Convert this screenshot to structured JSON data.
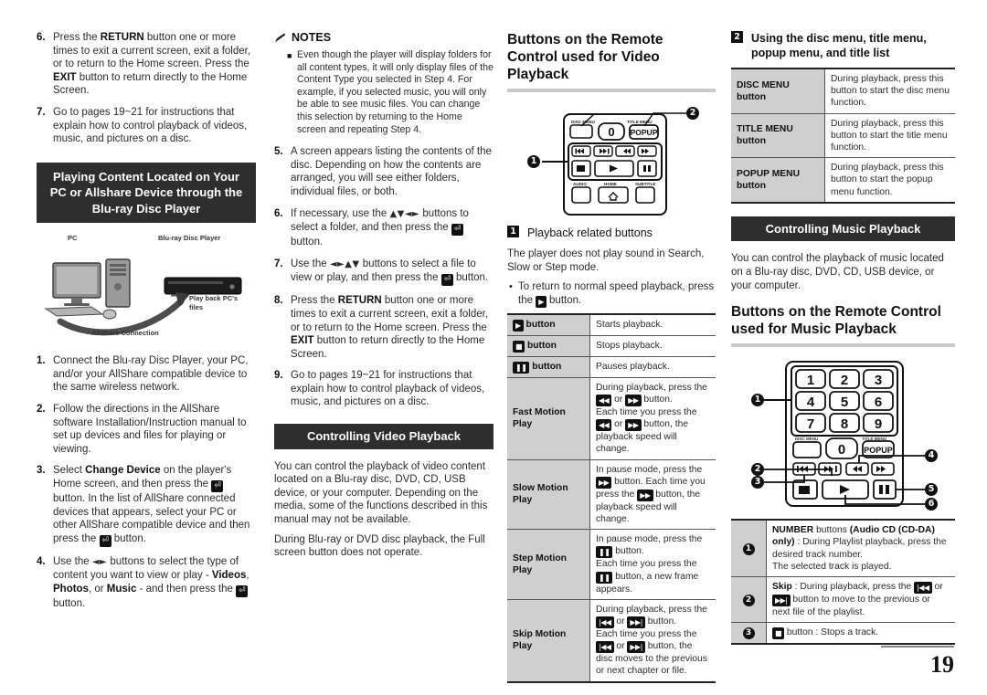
{
  "page_number": "19",
  "col1": {
    "steps_top": [
      {
        "num": "6.",
        "text": "Press the RETURN button one or more times to exit a current screen, exit a folder, or to return to the Home screen. Press the EXIT button to return directly to the Home Screen.",
        "bold_words": [
          "RETURN",
          "EXIT"
        ]
      },
      {
        "num": "7.",
        "text": "Go to pages 19~21 for instructions that explain how to control playback of videos, music, and pictures on a disc.",
        "bold_words": []
      }
    ],
    "section_title": "Playing Content Located on Your PC or Allshare Device through the Blu-ray Disc Player",
    "figure": {
      "name": "allshare-connection-diagram",
      "label_pc": "PC",
      "label_player": "Blu-ray Disc Player",
      "label_playback": "Play back PC's files",
      "label_connection": "AllShare Connection"
    },
    "steps_bottom": [
      {
        "num": "1.",
        "text": "Connect the Blu-ray Disc Player, your PC, and/or your AllShare compatible device to the same wireless network."
      },
      {
        "num": "2.",
        "text": "Follow the directions in the AllShare software Installation/Instruction manual to set up devices and files for playing or viewing."
      },
      {
        "num": "3.",
        "text": "Select Change Device on the player's Home screen, and then press the [E] button. In the list of AllShare connected devices that appears, select your PC or other AllShare compatible device and then press the [E] button."
      },
      {
        "num": "4.",
        "text": "Use the ◄► buttons to select the type of content you want to view or play - Videos, Photos, or Music - and then press the [E] button."
      }
    ]
  },
  "col2": {
    "notes_title": "NOTES",
    "notes_icon": "pencil-icon",
    "note_items": [
      "Even though the player will display folders for all content types, it will only display files of the Content Type you selected in Step 4. For example, if you selected music, you will only be able to see music files. You can change this selection by returning to the Home screen and repeating Step 4."
    ],
    "steps": [
      {
        "num": "5.",
        "text": "A screen appears listing the contents of the disc. Depending on how the contents are arranged, you will see either folders, individual files, or both."
      },
      {
        "num": "6.",
        "text": "If necessary, use the ▲▼◄► buttons to select a folder, and then press the [E] button."
      },
      {
        "num": "7.",
        "text": "Use the ◄►▲▼ buttons to select a file to view or play, and then press the [E] button."
      },
      {
        "num": "8.",
        "text": "Press the RETURN button one or more times to exit a current screen, exit a folder, or to return to the Home screen. Press the EXIT button to return directly to the Home Screen."
      },
      {
        "num": "9.",
        "text": "Go to pages 19~21 for instructions that explain how to control playback of videos, music, and pictures on a disc."
      }
    ],
    "section_title": "Controlling Video Playback",
    "paragraphs": [
      "You can control the playback of video content located on a Blu-ray disc, DVD, CD, USB device, or your computer. Depending on the media, some of the functions described in this manual may not be available.",
      "During Blu-ray or DVD disc playback, the Full screen button does not operate."
    ]
  },
  "col3": {
    "heading": "Buttons on the Remote Control used for Video Playback",
    "remote_figure": {
      "name": "video-remote-diagram",
      "label_disc_menu": "DISC MENU",
      "label_title_menu": "TITLE MENU",
      "label_popup": "POPUP",
      "label_zero": "0",
      "label_audio": "AUDIO",
      "label_home": "HOME",
      "label_subtitle": "SUBTITLE",
      "callout_1": "1",
      "callout_2": "2"
    },
    "callout_label": "Playback related buttons",
    "callout_number": "1",
    "intro": "The player does not play sound in Search, Slow or Step mode.",
    "bullet": "To return to normal speed playback, press the [play] button.",
    "table": [
      {
        "label_icon": "play-icon",
        "label": "button",
        "desc": "Starts playback."
      },
      {
        "label_icon": "stop-icon",
        "label": "button",
        "desc": "Stops playback."
      },
      {
        "label_icon": "pause-icon",
        "label": "button",
        "desc": "Pauses playback."
      },
      {
        "label_icon": "",
        "label": "Fast Motion Play",
        "desc": "During playback, press the [rew] or [ffwd] button.\nEach time you press the [rew] or [ffwd] button, the playback speed will change."
      },
      {
        "label_icon": "",
        "label": "Slow Motion Play",
        "desc": "In pause mode, press the [ffwd] button. Each time you press the [ffwd] button, the playback speed will change."
      },
      {
        "label_icon": "",
        "label": "Step Motion Play",
        "desc": "In pause mode, press the [pause] button.\nEach time you press the [pause] button, a new frame appears."
      },
      {
        "label_icon": "",
        "label": "Skip Motion Play",
        "desc": "During playback, press the [prev] or [next] button.\nEach time you press the [prev] or [next] button, the disc moves to the previous or next chapter or file."
      }
    ]
  },
  "col4": {
    "callout_number": "2",
    "callout_label": "Using the disc menu, title menu, popup menu, and title list",
    "menu_table": [
      {
        "label": "DISC MENU button",
        "desc": "During playback, press this button to start the disc menu function."
      },
      {
        "label": "TITLE MENU button",
        "desc": "During playback, press this button to start the title menu function."
      },
      {
        "label": "POPUP MENU button",
        "desc": "During playback, press this button to start the popup menu function."
      }
    ],
    "section_title": "Controlling Music Playback",
    "paragraph": "You can control the playback of music located on a Blu-ray disc, DVD, CD, USB device, or your computer.",
    "heading": "Buttons on the Remote Control used for Music Playback",
    "remote_figure": {
      "name": "music-remote-diagram",
      "keys": [
        "1",
        "2",
        "3",
        "4",
        "5",
        "6",
        "7",
        "8",
        "9",
        "0"
      ],
      "label_disc_menu": "DISC MENU",
      "label_title_menu": "TITLE MENU",
      "label_popup": "POPUP",
      "callouts": [
        "1",
        "2",
        "3",
        "4",
        "5",
        "6"
      ]
    },
    "music_table": [
      {
        "num": "1",
        "desc": "NUMBER buttons (Audio CD (CD-DA) only) : During Playlist playback, press the desired track number.\nThe selected track is played."
      },
      {
        "num": "2",
        "desc": "Skip : During playback, press the [prev] or [next] button to move to the previous or next file of the playlist."
      },
      {
        "num": "3",
        "desc": "[stop] button : Stops a track."
      }
    ]
  }
}
